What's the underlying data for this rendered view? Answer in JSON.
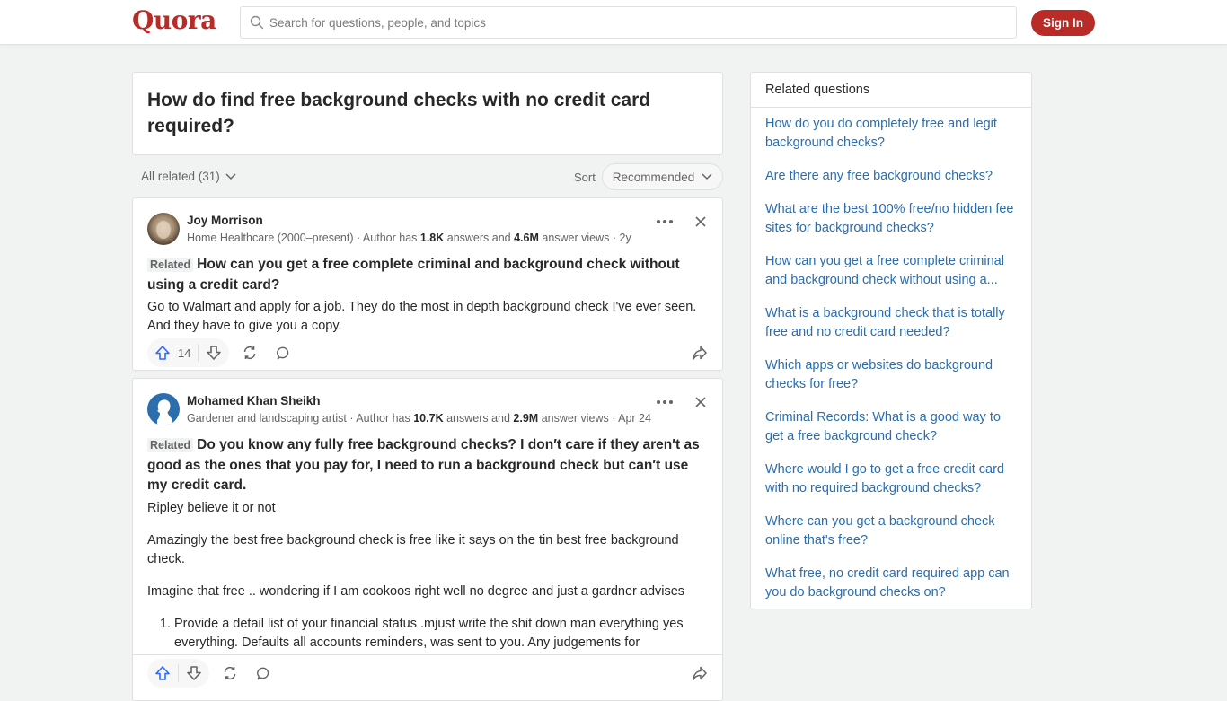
{
  "header": {
    "logo": "Quora",
    "search_placeholder": "Search for questions, people, and topics",
    "signin_label": "Sign In"
  },
  "question": {
    "title": "How do find free background checks with no credit card required?"
  },
  "filter": {
    "all_related_label": "All related (31)",
    "sort_label": "Sort",
    "sort_value": "Recommended"
  },
  "answers": [
    {
      "author_name": "Joy Morrison",
      "credential_prefix": "Home Healthcare (2000–present) · Author has ",
      "answers_count": "1.8K",
      "answers_mid": " answers and ",
      "views_count": "4.6M",
      "credential_suffix": " answer views · 2y",
      "related_tag": "Related",
      "related_question": "How can you get a free complete criminal and background check without using a credit card?",
      "paragraphs": [
        "Go to Walmart and apply for a job. They do the most in depth background check I've ever seen. And they have to give you a copy."
      ],
      "upvotes": "14"
    },
    {
      "author_name": "Mohamed Khan Sheikh",
      "credential_prefix": "Gardener and landscaping artist · Author has ",
      "answers_count": "10.7K",
      "answers_mid": " answers and ",
      "views_count": "2.9M",
      "credential_suffix": " answer views · Apr 24",
      "related_tag": "Related",
      "related_question": "Do you know any fully free background checks? I don′t care if they aren′t as good as the ones that you pay for, I need to run a background check but can′t use my credit card.",
      "paragraphs": [
        "Ripley believe it or not",
        "Amazingly the best free background check is free like it says on the tin best free background check.",
        "Imagine that free .. wondering if I am cookoos right well no degree and just a gardner advises"
      ],
      "list_items": [
        "Provide a detail list of your financial status .mjust write the shit down man everything yes everything. Defaults all accounts reminders, was sent to you. Any judgements for"
      ]
    }
  ],
  "sidebar": {
    "title": "Related questions",
    "items": [
      "How do you do completely free and legit background checks?",
      "Are there any free background checks?",
      "What are the best 100% free/no hidden fee sites for background checks?",
      "How can you get a free complete criminal and background check without using a...",
      "What is a background check that is totally free and no credit card needed?",
      "Which apps or websites do background checks for free?",
      "Criminal Records: What is a good way to get a free background check?",
      "Where would I go to get a free credit card with no required background checks?",
      "Where can you get a background check online that's free?",
      "What free, no credit card required app can you do background checks on?"
    ]
  },
  "colors": {
    "brand": "#b92b27",
    "link": "#2b6dad",
    "upvote": "#2e69ff"
  }
}
